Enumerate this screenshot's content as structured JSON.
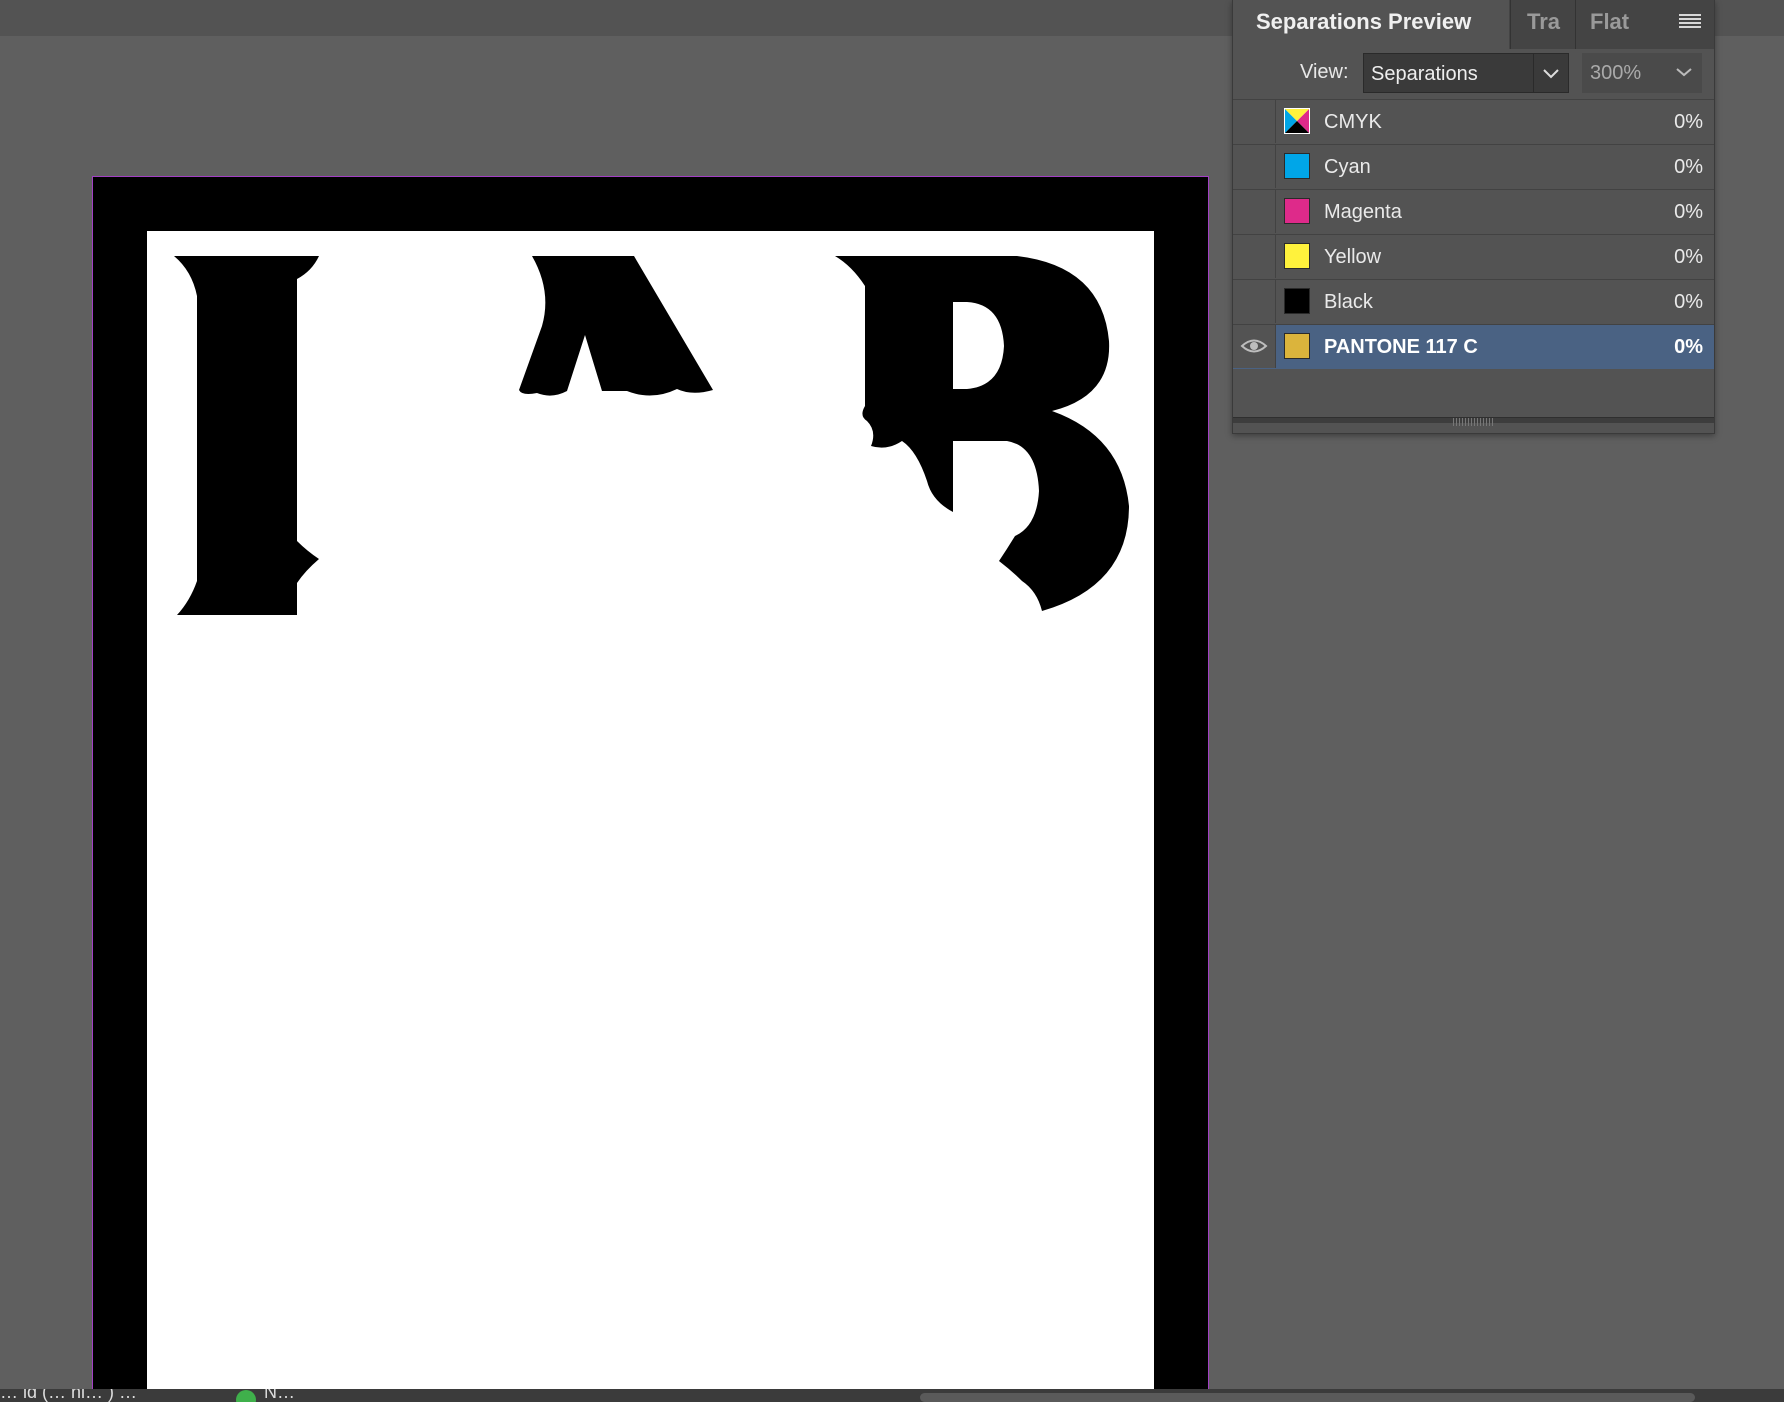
{
  "panel": {
    "tabs": [
      {
        "label": "Separations Preview"
      },
      {
        "label": "Tra"
      },
      {
        "label": "Flat"
      }
    ],
    "view_label": "View:",
    "view_value": "Separations",
    "zoom_value": "300%",
    "separations": [
      {
        "name": "CMYK",
        "value": "0%",
        "color": "cmyk",
        "visible": false,
        "selected": false
      },
      {
        "name": "Cyan",
        "value": "0%",
        "color": "#00a6e8",
        "visible": false,
        "selected": false
      },
      {
        "name": "Magenta",
        "value": "0%",
        "color": "#de2a8a",
        "visible": false,
        "selected": false
      },
      {
        "name": "Yellow",
        "value": "0%",
        "color": "#fff23c",
        "visible": false,
        "selected": false
      },
      {
        "name": "Black",
        "value": "0%",
        "color": "#000000",
        "visible": false,
        "selected": false
      },
      {
        "name": "PANTONE 117 C",
        "value": "0%",
        "color": "#dbb43c",
        "visible": true,
        "selected": true
      }
    ]
  },
  "document": {
    "frame_color": "#000000",
    "page_color": "#ffffff",
    "guide_color": "#a23fc4"
  },
  "statusbar": {
    "left_text": "… id (… hi… )  …",
    "ok_text": "N…"
  }
}
